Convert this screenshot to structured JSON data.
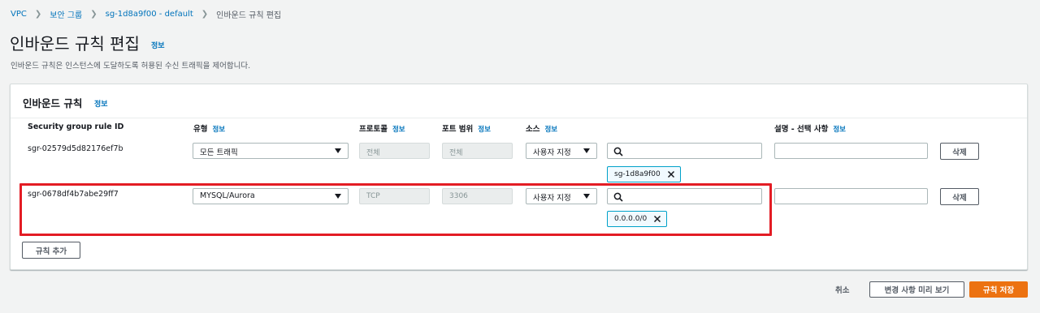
{
  "breadcrumb": {
    "items": [
      "VPC",
      "보안 그룹",
      "sg-1d8a9f00 - default"
    ],
    "current": "인바운드 규칙 편집"
  },
  "page": {
    "title": "인바운드 규칙 편집",
    "info": "정보",
    "description": "인바운드 규칙은 인스턴스에 도달하도록 허용된 수신 트래픽을 제어합니다."
  },
  "panel": {
    "title": "인바운드 규칙",
    "info": "정보",
    "columns": {
      "rule_id": "Security group rule ID",
      "type": "유형",
      "protocol": "프로토콜",
      "port_range": "포트 범위",
      "source": "소스",
      "description": "설명 - 선택 사항",
      "info": "정보"
    },
    "rules": [
      {
        "id": "sgr-02579d5d82176ef7b",
        "type": "모든 트래픽",
        "protocol": "전체",
        "port_range": "전체",
        "source_type": "사용자 지정",
        "source_token": "sg-1d8a9f00",
        "description": "",
        "delete_label": "삭제"
      },
      {
        "id": "sgr-0678df4b7abe29ff7",
        "type": "MYSQL/Aurora",
        "protocol": "TCP",
        "port_range": "3306",
        "source_type": "사용자 지정",
        "source_token": "0.0.0.0/0",
        "description": "",
        "delete_label": "삭제"
      }
    ],
    "add_rule_label": "규칙 추가"
  },
  "footer": {
    "cancel_label": "취소",
    "preview_label": "변경 사항 미리 보기",
    "save_label": "규칙 저장"
  },
  "colors": {
    "accent": "#ec7211",
    "link": "#0073bb",
    "highlight": "#e31c24",
    "token_border": "#00a1c9"
  }
}
